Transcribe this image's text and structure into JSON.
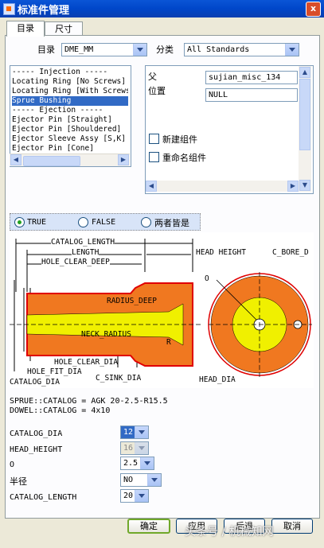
{
  "window": {
    "title": "标准件管理",
    "close_glyph": "x"
  },
  "tabs": [
    "目录",
    "尺寸"
  ],
  "catalog": {
    "label": "目录",
    "value": "DME_MM"
  },
  "category": {
    "label": "分类",
    "value": "All Standards"
  },
  "list": {
    "items": [
      "----- Injection -----",
      "Locating Ring [No Screws]",
      "Locating Ring [With Screws]",
      "Sprue Bushing",
      "----- Ejection -----",
      "Ejector Pin [Straight]",
      "Ejector Pin [Shouldered]",
      "Ejector Sleeve Assy [S,K]",
      "Ejector Pin [Cone]"
    ],
    "selected_index": 3
  },
  "parent": {
    "label": "父",
    "value": "sujian_misc_134"
  },
  "position": {
    "label": "位置",
    "value": "NULL"
  },
  "checks": {
    "new_component": "新建组件",
    "rename_component": "重命名组件"
  },
  "radios": {
    "true_label": "TRUE",
    "false_label": "FALSE",
    "both_label": "两者皆是",
    "selected": "TRUE"
  },
  "diagram_labels": {
    "catalog_length": "CATALOG_LENGTH",
    "length": "LENGTH",
    "hole_clear_deep": "HOLE_CLEAR_DEEP",
    "head_height": "HEAD HEIGHT",
    "c_bore": "C_BORE_D",
    "radius_deep": "RADIUS_DEEP",
    "neck_radius": "NECK_RADIUS",
    "r": "R",
    "o": "O",
    "hole_clear_dia": "HOLE_CLEAR_DIA",
    "hole_fit_dia": "HOLE_FIT_DIA",
    "catalog_dia": "CATALOG_DIA",
    "c_sink_dia": "C_SINK_DIA",
    "head_dia": "HEAD_DIA"
  },
  "catalog_text": {
    "sprue": "SPRUE::CATALOG = AGK 20-2.5-R15.5",
    "dowel": "DOWEL::CATALOG = 4x10"
  },
  "params": [
    {
      "label": "CATALOG_DIA",
      "value": "12",
      "disabled": false
    },
    {
      "label": "HEAD_HEIGHT",
      "value": "16",
      "disabled": true
    },
    {
      "label": "O",
      "value": "2.5",
      "disabled": false
    },
    {
      "label": "半径",
      "value": "NO",
      "disabled": false
    },
    {
      "label": "CATALOG_LENGTH",
      "value": "20",
      "disabled": false
    }
  ],
  "buttons": {
    "ok": "确定",
    "apply": "应用",
    "back": "后退",
    "cancel": "取消"
  },
  "watermark": "头条号 / 机械知网",
  "colors": {
    "title_bar": "#0a55d6",
    "selection": "#316ac5",
    "diagram_orange": "#f07820",
    "diagram_yellow": "#f0f000",
    "diagram_red": "#e00000"
  }
}
